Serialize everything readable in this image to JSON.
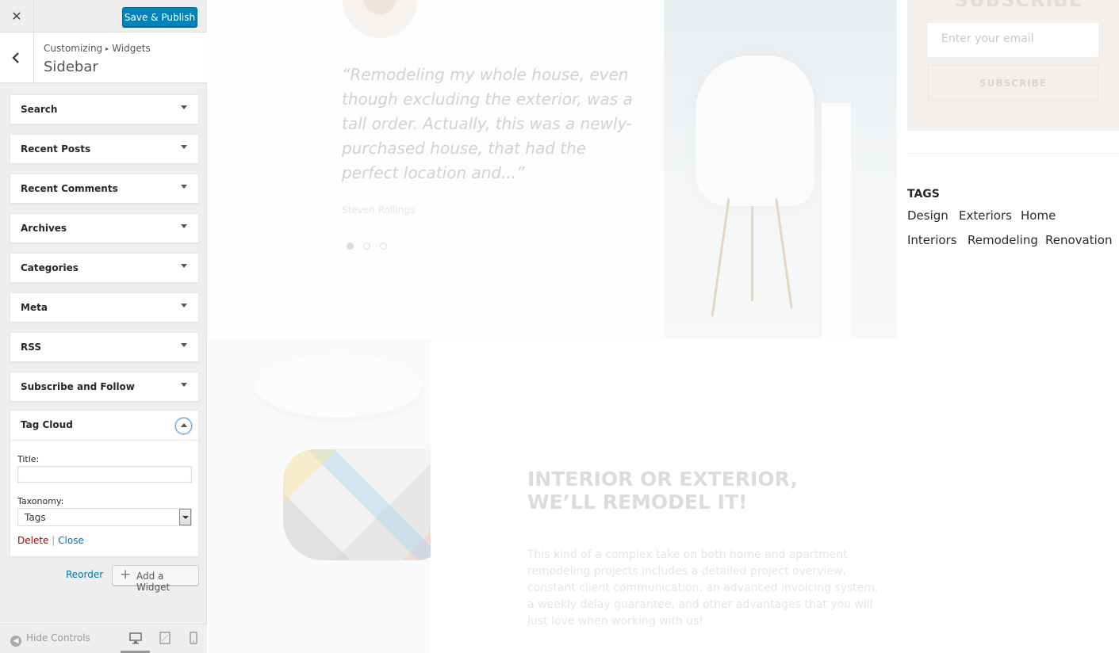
{
  "customizer": {
    "close_icon": "close-icon",
    "save_label": "Save & Publish",
    "breadcrumb": {
      "root": "Customizing",
      "current": "Widgets"
    },
    "panel_title": "Sidebar",
    "widgets": [
      "Search",
      "Recent Posts",
      "Recent Comments",
      "Archives",
      "Categories",
      "Meta",
      "RSS",
      "Subscribe and Follow"
    ],
    "open_widget": {
      "title": "Tag Cloud",
      "title_label": "Title:",
      "title_value": "",
      "taxonomy_label": "Taxonomy:",
      "taxonomy_value": "Tags",
      "delete_label": "Delete",
      "separator": "|",
      "close_label": "Close"
    },
    "reorder_label": "Reorder",
    "add_widget_label": "Add a Widget",
    "hide_controls_label": "Hide Controls",
    "colors": {
      "primary": "#0085ba",
      "link": "#0073aa",
      "delete": "#a00"
    }
  },
  "preview": {
    "testimonial": {
      "quote": "“Remodeling my whole house, even though excluding the exterior, was a tall order. Actually, this was a newly-purchased house, that had the perfect location and...”",
      "author": "Steven Rollings"
    },
    "subscribe": {
      "title": "SUBSCRIBE",
      "email_placeholder": "Enter your email",
      "button_label": "SUBSCRIBE"
    },
    "tags": {
      "title": "TAGS",
      "items": [
        "Design",
        "Exteriors",
        "Home",
        "Interiors",
        "Remodeling",
        "Renovation"
      ]
    },
    "feature": {
      "headline_line1": "INTERIOR OR EXTERIOR,",
      "headline_line2": "WE’LL REMODEL IT!",
      "body": "This kind of a complex take on both home and apartment remodeling projects includes a detailed project overview, constant client communication, an advanced invoicing system, a weekly delay guarantee, and other advantages that you will just love when working with us!"
    }
  }
}
